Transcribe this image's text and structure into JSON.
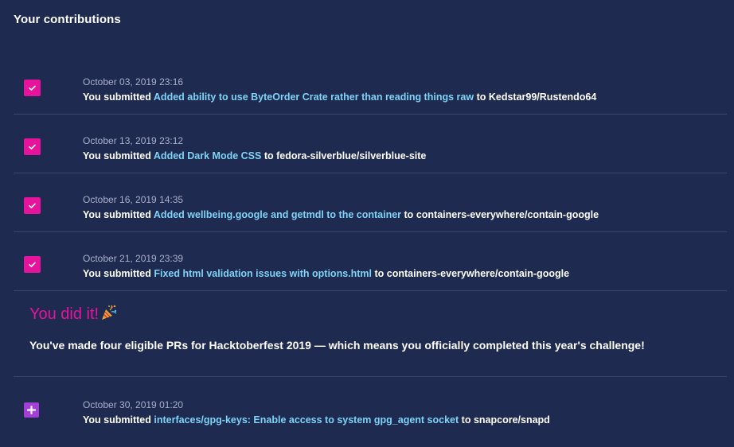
{
  "header": {
    "title": "Your contributions"
  },
  "contributions": [
    {
      "date": "October 03, 2019 23:16",
      "prefix": "You submitted",
      "pr_title": "Added ability to use ByteOrder Crate rather than reading things raw",
      "to": "to",
      "repo": "Kedstar99/Rustendo64",
      "status_icon": "check-icon"
    },
    {
      "date": "October 13, 2019 23:12",
      "prefix": "You submitted",
      "pr_title": "Added Dark Mode CSS",
      "to": "to",
      "repo": "fedora-silverblue/silverblue-site",
      "status_icon": "check-icon"
    },
    {
      "date": "October 16, 2019 14:35",
      "prefix": "You submitted",
      "pr_title": "Added wellbeing.google and getmdl to the container",
      "to": "to",
      "repo": "containers-everywhere/contain-google",
      "status_icon": "check-icon"
    },
    {
      "date": "October 21, 2019 23:39",
      "prefix": "You submitted",
      "pr_title": "Fixed html validation issues with options.html",
      "to": "to",
      "repo": "containers-everywhere/contain-google",
      "status_icon": "check-icon"
    }
  ],
  "celebration": {
    "title": "You did it!",
    "icon": "party-popper-icon",
    "message": "You've made four eligible PRs for Hacktoberfest 2019 — which means you officially completed this year's challenge!"
  },
  "extra_contribution": {
    "date": "October 30, 2019 01:20",
    "prefix": "You submitted",
    "pr_title": "interfaces/gpg-keys: Enable access to system gpg_agent socket",
    "to": "to",
    "repo": "snapcore/snapd",
    "status_icon": "plus-icon"
  },
  "colors": {
    "background": "#1f2a50",
    "accent_pink": "#e6139c",
    "accent_purple": "#a33fd6",
    "link": "#7fd3f5",
    "date_text": "#a9b0cc",
    "divider": "#3a4670"
  }
}
